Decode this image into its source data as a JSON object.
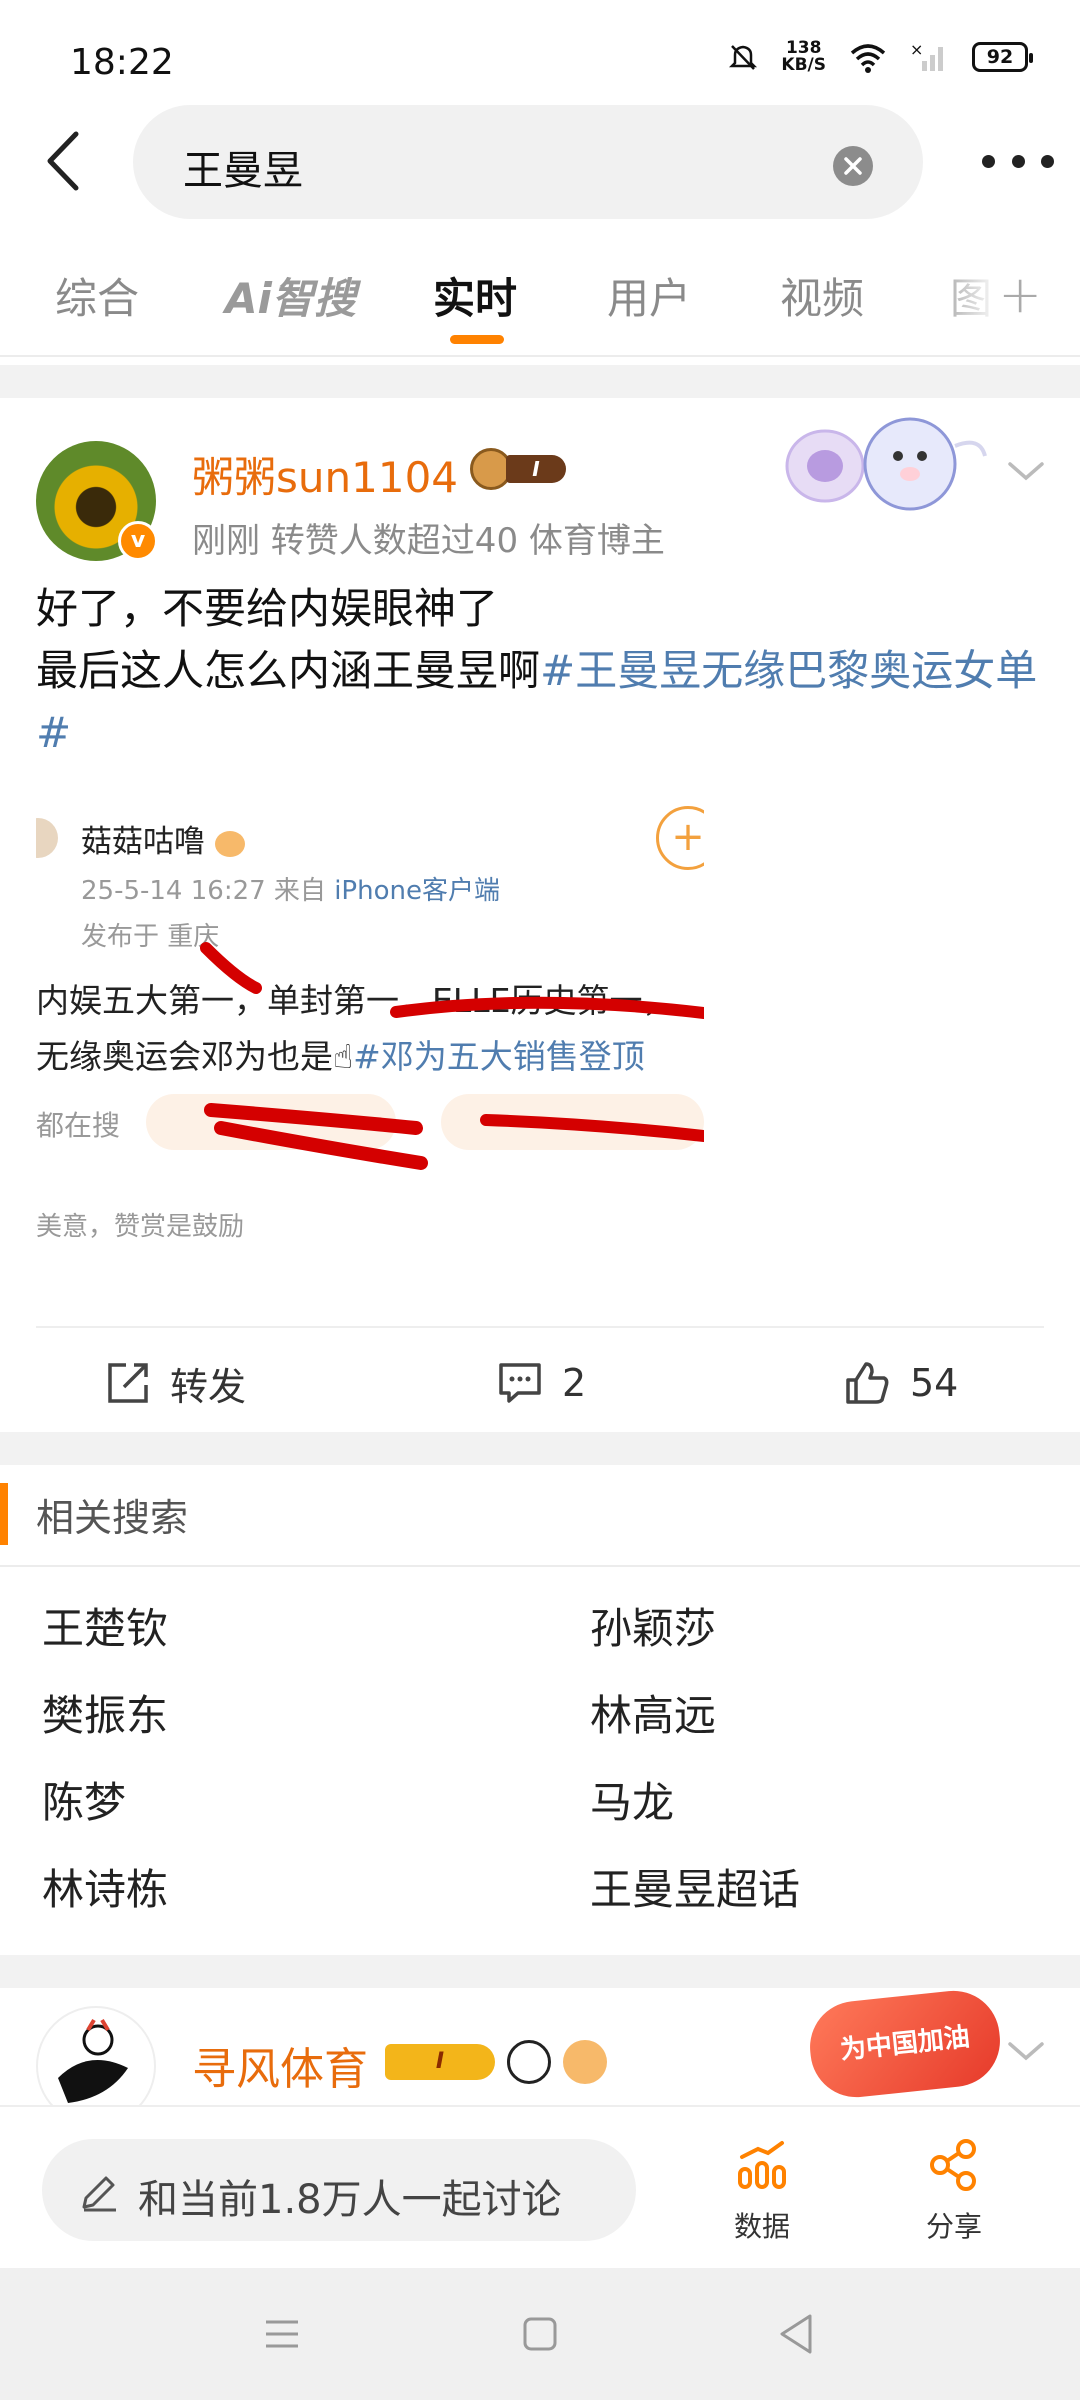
{
  "status_bar": {
    "time": "18:22",
    "net_speed_value": "138",
    "net_speed_unit": "KB/S",
    "battery": "92"
  },
  "search": {
    "query": "王曼昱"
  },
  "tabs": [
    {
      "label": "综合"
    },
    {
      "label": "Ai智搜"
    },
    {
      "label": "实时"
    },
    {
      "label": "用户"
    },
    {
      "label": "视频"
    },
    {
      "label": "图"
    }
  ],
  "post": {
    "username": "粥粥sun1104",
    "level": "I",
    "meta": "刚刚 转赞人数超过40  体育博主",
    "line1": "好了，不要给内娱眼神了",
    "line2_text": "最后这人怎么内涵王曼昱啊",
    "hashtag": "#王曼昱无缘巴黎奥运女单#",
    "embed": {
      "name": "菇菇咕噜",
      "date": "25-5-14 16:27  来自 ",
      "device": "iPhone客户端",
      "location": "发布于 重庆",
      "text_line1": "内娱五大第一，单封第一，ELLE历史第一，",
      "text_line2_plain": "无缘奥运会邓为也是",
      "text_line2_tag": "#邓为五大销售登顶",
      "hot_label": "都在搜",
      "tip": "美意，赞赏是鼓励"
    },
    "actions": {
      "repost_label": "转发",
      "comment_count": "2",
      "like_count": "54"
    }
  },
  "related": {
    "title": "相关搜索",
    "items": [
      "王楚钦",
      "孙颖莎",
      "樊振东",
      "林高远",
      "陈梦",
      "马龙",
      "林诗栋",
      "王曼昱超话"
    ]
  },
  "post2": {
    "username": "寻风体育",
    "level": "I",
    "badge": "为中国加油"
  },
  "bottom_bar": {
    "comment_placeholder": "和当前1.8万人一起讨论",
    "data_label": "数据",
    "share_label": "分享"
  },
  "colors": {
    "accent": "#ff8200",
    "username": "#e86c0c",
    "link": "#507daf"
  }
}
